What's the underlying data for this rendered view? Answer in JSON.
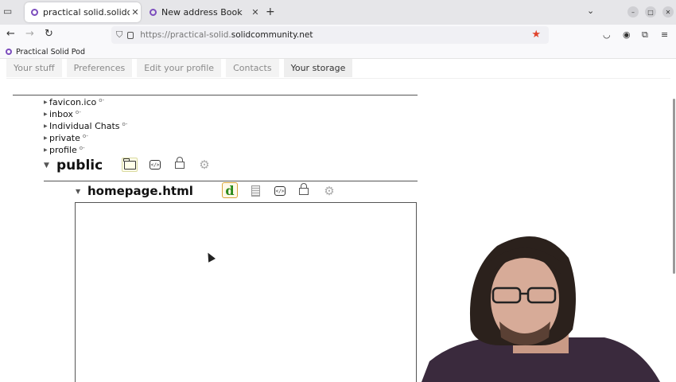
{
  "browser": {
    "tabs": [
      {
        "title": "practical solid.solidcommu",
        "active": true
      },
      {
        "title": "New address Book",
        "active": false
      }
    ],
    "url_prefix": "https://practical-solid.",
    "url_domain": "solidcommunity.net",
    "bookmark": "Practical Solid Pod"
  },
  "page_tabs": [
    "Your stuff",
    "Preferences",
    "Edit your profile",
    "Contacts",
    "Your storage"
  ],
  "files": [
    "favicon.ico",
    "inbox",
    "Individual Chats",
    "private",
    "profile"
  ],
  "folder": {
    "name": "public"
  },
  "file": {
    "name": "homepage.html"
  },
  "icons": {
    "key": "key-icon",
    "folder": "folder-icon",
    "code": "code-icon",
    "lock": "lock-icon",
    "gear": "gear-icon",
    "doc": "document-icon",
    "dokieli": "dokieli-icon"
  },
  "colors": {
    "accent": "#7c4dbd",
    "star": "#e0432c",
    "dokieli_green": "#2b8a1a"
  }
}
